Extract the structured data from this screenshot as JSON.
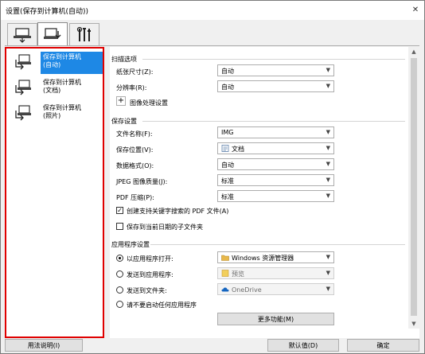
{
  "window": {
    "title": "设置(保存到计算机(自动))"
  },
  "tabs": [
    {
      "name": "scan-tab",
      "icon": "scanner-icon"
    },
    {
      "name": "save-tab",
      "icon": "save-to-computer-icon"
    },
    {
      "name": "tools-tab",
      "icon": "tools-icon"
    }
  ],
  "left_list": [
    {
      "label": "保存到计算机\n(自动)",
      "selected": true
    },
    {
      "label": "保存到计算机\n(文档)",
      "selected": false
    },
    {
      "label": "保存到计算机\n(照片)",
      "selected": false
    }
  ],
  "scan_options": {
    "section_title": "扫描选项",
    "paper_size_label": "纸张尺寸(Z):",
    "paper_size_value": "自动",
    "resolution_label": "分辨率(R):",
    "resolution_value": "自动",
    "image_processing_label": "图像处理设置"
  },
  "save_settings": {
    "section_title": "保存设置",
    "filename_label": "文件名称(F):",
    "filename_value": "IMG",
    "save_in_label": "保存位置(V):",
    "save_in_value": "文档",
    "data_format_label": "数据格式(O):",
    "data_format_value": "自动",
    "jpeg_quality_label": "JPEG 图像质量(J):",
    "jpeg_quality_value": "标准",
    "pdf_compression_label": "PDF 压缩(P):",
    "pdf_compression_value": "标准",
    "keyword_pdf_label": "创建支持关键字搜索的 PDF 文件(A)",
    "keyword_pdf_checked": true,
    "subfolder_label": "保存到当前日期的子文件夹",
    "subfolder_checked": false
  },
  "app_settings": {
    "section_title": "应用程序设置",
    "open_app_label": "以应用程序打开:",
    "open_app_value": "Windows 资源管理器",
    "send_app_label": "发送到应用程序:",
    "send_app_value": "预览",
    "send_folder_label": "发送到文件夹:",
    "send_folder_value": "OneDrive",
    "no_app_label": "请不要启动任何应用程序",
    "selected_option": "open_app",
    "more_functions_label": "更多功能(M)"
  },
  "footer": {
    "help_label": "用法说明(I)",
    "defaults_label": "默认值(D)",
    "ok_label": "确定"
  },
  "colors": {
    "selection": "#1e88e5",
    "highlight_border": "#e00000"
  }
}
